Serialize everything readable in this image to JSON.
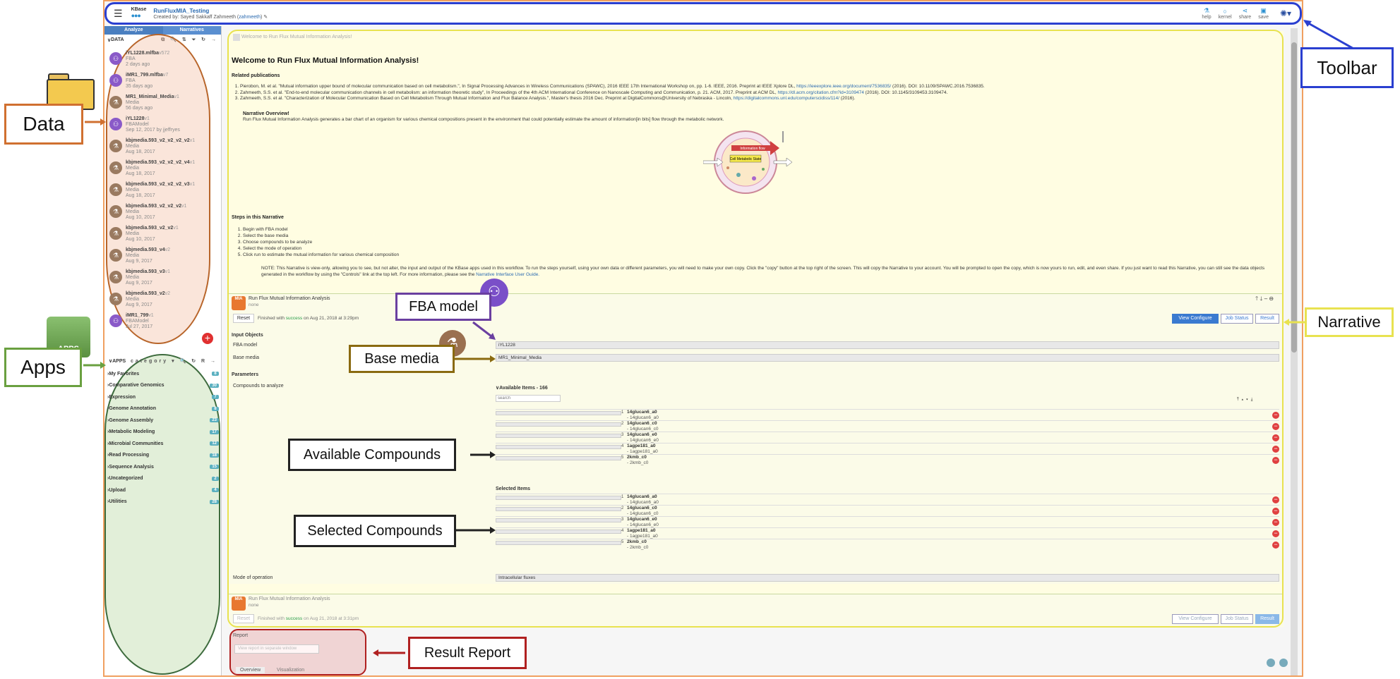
{
  "toolbar": {
    "logo_text": "KBase",
    "narrative_title": "RunFluxMIA_Testing",
    "created_by_prefix": "Created by: Sayed Sakkaff Zahmeeth (",
    "username": "zahmeeth",
    "created_by_suffix": ")",
    "buttons": [
      {
        "label": "help",
        "icon": "help-icon"
      },
      {
        "label": "kernel",
        "icon": "kernel-icon"
      },
      {
        "label": "share",
        "icon": "share-icon"
      },
      {
        "label": "save",
        "icon": "save-icon"
      }
    ]
  },
  "left_panel": {
    "tabs": [
      "Analyze",
      "Narratives"
    ],
    "data_header": "DATA",
    "data_items": [
      {
        "name": "iYL1228.mlfba",
        "version": "v572",
        "type": "FBA",
        "date": "2 days ago",
        "color": "#8a5ac8",
        "glyph": "⚇"
      },
      {
        "name": "iMR1_799.mlfba",
        "version": "v7",
        "type": "FBA",
        "date": "35 days ago",
        "color": "#8a5ac8",
        "glyph": "⚇"
      },
      {
        "name": "MR1_Minimal_Media",
        "version": "v1",
        "type": "Media",
        "date": "56 days ago",
        "color": "#9a7a60",
        "glyph": "⚗"
      },
      {
        "name": "iYL1228",
        "version": "v1",
        "type": "FBAModel",
        "date": "Sep 12, 2017 by jjeffryes",
        "color": "#8a5ac8",
        "glyph": "⚇"
      },
      {
        "name": "kbjmedia.593_v2_v2_v2_v2",
        "version": "v1",
        "type": "Media",
        "date": "Aug 18, 2017",
        "color": "#9a7a60",
        "glyph": "⚗"
      },
      {
        "name": "kbjmedia.593_v2_v2_v2_v4",
        "version": "v1",
        "type": "Media",
        "date": "Aug 18, 2017",
        "color": "#9a7a60",
        "glyph": "⚗"
      },
      {
        "name": "kbjmedia.593_v2_v2_v2_v3",
        "version": "v1",
        "type": "Media",
        "date": "Aug 18, 2017",
        "color": "#9a7a60",
        "glyph": "⚗"
      },
      {
        "name": "kbjmedia.593_v2_v2_v2",
        "version": "v1",
        "type": "Media",
        "date": "Aug 10, 2017",
        "color": "#9a7a60",
        "glyph": "⚗"
      },
      {
        "name": "kbjmedia.593_v2_v2",
        "version": "v1",
        "type": "Media",
        "date": "Aug 10, 2017",
        "color": "#9a7a60",
        "glyph": "⚗"
      },
      {
        "name": "kbjmedia.593_v4",
        "version": "v2",
        "type": "Media",
        "date": "Aug 9, 2017",
        "color": "#9a7a60",
        "glyph": "⚗"
      },
      {
        "name": "kbjmedia.593_v3",
        "version": "v1",
        "type": "Media",
        "date": "Aug 9, 2017",
        "color": "#9a7a60",
        "glyph": "⚗"
      },
      {
        "name": "kbjmedia.593_v2",
        "version": "v2",
        "type": "Media",
        "date": "Aug 9, 2017",
        "color": "#9a7a60",
        "glyph": "⚗"
      },
      {
        "name": "iMR1_799",
        "version": "v1",
        "type": "FBAModel",
        "date": "Jul 27, 2017",
        "color": "#8a5ac8",
        "glyph": "⚇"
      }
    ],
    "apps_header": "APPS",
    "apps_category_label": "category",
    "app_categories": [
      {
        "name": "My Favorites",
        "count": "8"
      },
      {
        "name": "Comparative Genomics",
        "count": "30"
      },
      {
        "name": "Expression",
        "count": "7"
      },
      {
        "name": "Genome Annotation",
        "count": "8"
      },
      {
        "name": "Genome Assembly",
        "count": "23"
      },
      {
        "name": "Metabolic Modeling",
        "count": "17"
      },
      {
        "name": "Microbial Communities",
        "count": "12"
      },
      {
        "name": "Read Processing",
        "count": "18"
      },
      {
        "name": "Sequence Analysis",
        "count": "15"
      },
      {
        "name": "Uncategorized",
        "count": "2"
      },
      {
        "name": "Upload",
        "count": "4"
      },
      {
        "name": "Utilities",
        "count": "28"
      }
    ]
  },
  "narrative": {
    "md_cell_header": "Welcome to Run Flux Mutual Information Analysis!",
    "heading": "Welcome to Run Flux Mutual Information Analysis!",
    "related_pubs_title": "Related publications",
    "pubs": [
      {
        "text": "Pierobon, M. et al. \"Mutual information upper bound of molecular communication based on cell metabolism.\", In Signal Processing Advances in Wireless Communications (SPAWC), 2016 IEEE 17th International Workshop on, pp. 1-6. IEEE, 2016. Preprint at IEEE Xplore DL,",
        "link": "https://ieeexplore.ieee.org/document/7536835/",
        "tail": "(2016). DOI: 10.1109/SPAWC.2016.7536835."
      },
      {
        "text": "Zahmeeth, S.S. et al. \"End-to-end molecular communication channels in cell metabolism: an information theoretic study\", In Proceedings of the 4th ACM International Conference on Nanoscale Computing and Communication, p. 21. ACM, 2017. Preprint at ACM DL,",
        "link": "https://dl.acm.org/citation.cfm?id=3109474",
        "tail": "(2016). DOI: 10.1145/3109453.3109474."
      },
      {
        "text": "Zahmeeth, S.S. et al. \"Characterization of Molecular Communication Based on Cell Metabolism Through Mutual Information and Flux Balance Analysis.\", Master's thesis 2016 Dec. Preprint at DigitalCommons@University of Nebraska - Lincoln,",
        "link": "https://digitalcommons.unl.edu/computerscidiss/114/",
        "tail": "(2016)."
      }
    ],
    "overview_title": "Narrative Overview!",
    "overview_text": "Run Flux Mutual Information Analysis generates a bar chart of an organism for various chemical compositions present in the environment that could potentially estimate the amount of information[in bits] flow through the metabolic network.",
    "diagram_labels": {
      "flow": "Information flow",
      "state": "Cell Metabolic State"
    },
    "steps_title": "Steps in this Narrative",
    "steps": [
      "Begin with FBA model",
      "Select the base media",
      "Choose compounds to be analyze",
      "Select the mode of operation",
      "Click run to estimate the mutual information for various chemical composition"
    ],
    "note": "NOTE: This Narrative is view-only, allowing you to see, but not alter, the input and output of the KBase apps used in this workflow. To run the steps yourself, using your own data or different parameters, you will need to make your own copy. Click the \"copy\" button at the top right of the screen. This will copy the Narrative to your account. You will be prompted to open the copy, which is now yours to run, edit, and even share. If you just want to read this Narrative, you can still see the data objects generated in the workflow by using the \"Controls\" link at the top left. For more information, please see the",
    "note_link": "Narrative Interface User Guide."
  },
  "app_cell": {
    "title": "Run Flux Mutual Information Analysis",
    "subtitle": "none",
    "reset_label": "Reset",
    "status_prefix": "Finished with ",
    "status_word": "success",
    "status_suffix": " on Aug 21, 2018 at 3:29pm",
    "tabs": [
      "View Configure",
      "Job Status",
      "Result"
    ],
    "input_objects_label": "Input Objects",
    "fba_model_label": "FBA model",
    "fba_model_value": "iYL1228",
    "base_media_label": "Base media",
    "base_media_value": "MR1_Minimal_Media",
    "parameters_label": "Parameters",
    "compounds_label": "Compounds to analyze",
    "available_header": "Available Items - 166",
    "search_placeholder": "search",
    "available_items": [
      {
        "num": "1",
        "name": "14glucan6_a0",
        "id": "- 14glucan6_a0"
      },
      {
        "num": "2",
        "name": "14glucan6_c0",
        "id": "- 14glucan6_c0"
      },
      {
        "num": "3",
        "name": "14glucan6_e0",
        "id": "- 14glucan6_e0"
      },
      {
        "num": "4",
        "name": "1agpe181_a0",
        "id": "- 1agpe181_a0"
      },
      {
        "num": "5",
        "name": "2kmb_c0",
        "id": "- 2kmb_c0"
      }
    ],
    "selected_header": "Selected Items",
    "selected_items": [
      {
        "num": "1",
        "name": "14glucan6_a0",
        "id": "- 14glucan6_a0"
      },
      {
        "num": "2",
        "name": "14glucan6_c0",
        "id": "- 14glucan6_c0"
      },
      {
        "num": "3",
        "name": "14glucan6_e0",
        "id": "- 14glucan6_e0"
      },
      {
        "num": "4",
        "name": "1agpe181_a0",
        "id": "- 1agpe181_a0"
      },
      {
        "num": "5",
        "name": "2kmb_c0",
        "id": "- 2kmb_c0"
      }
    ],
    "mode_label": "Mode of operation",
    "mode_value": "Intracellular fluxes"
  },
  "app_cell_2": {
    "title": "Run Flux Mutual Information Analysis",
    "subtitle": "none",
    "reset_label": "Reset",
    "status_prefix": "Finished with ",
    "status_word": "success",
    "status_suffix": " on Aug 21, 2018 at 3:31pm",
    "tabs": [
      "View Configure",
      "Job Status",
      "Result"
    ]
  },
  "report": {
    "title": "Report",
    "view_button": "View report in separate window",
    "tabs": [
      "Overview",
      "Visualization"
    ]
  },
  "callouts": {
    "data": "Data",
    "apps": "Apps",
    "apps_badge": "APPS",
    "toolbar": "Toolbar",
    "narrative": "Narrative",
    "fba_model": "FBA model",
    "base_media": "Base media",
    "available": "Available Compounds",
    "selected": "Selected Compounds",
    "result_report": "Result Report"
  },
  "colors": {
    "toolbar_outline": "#2a3fd0",
    "data_outline": "#b8652a",
    "apps_outline": "#3d6b3d",
    "narrative_outline": "#e8e250",
    "result_outline": "#b02020",
    "fba_outline": "#6a3fa0",
    "media_outline": "#8a6a10"
  }
}
